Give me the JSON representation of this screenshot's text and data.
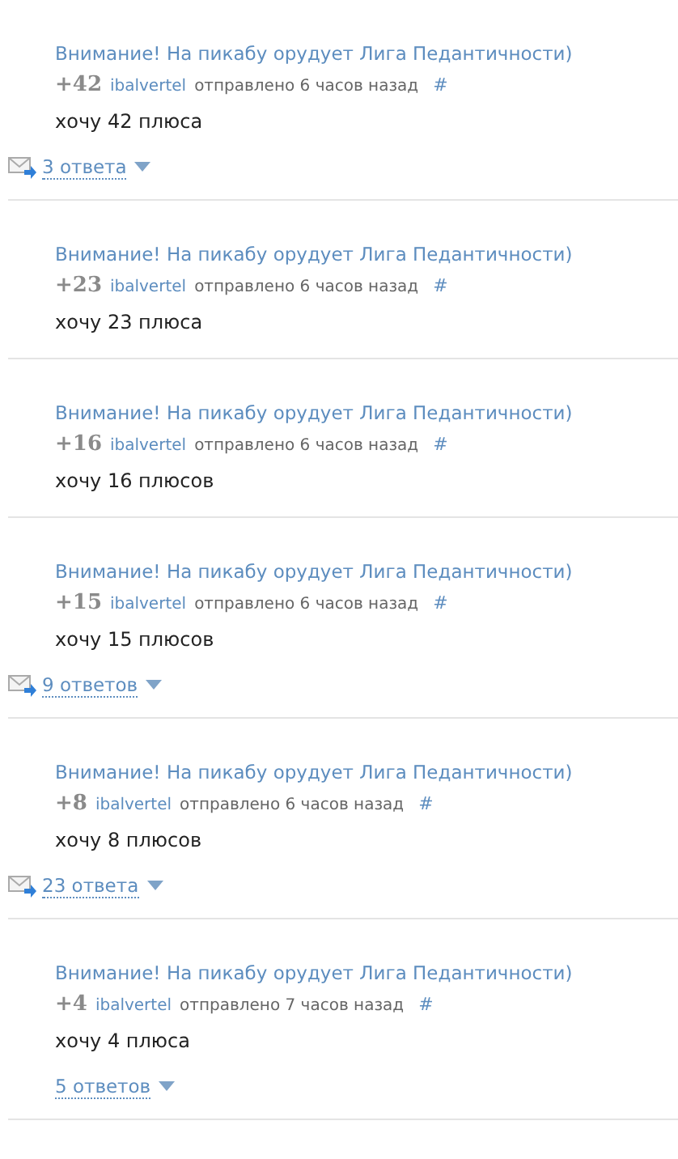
{
  "comments": [
    {
      "title": "Внимание! На пикабу орудует Лига Педантичности)",
      "score": "+42",
      "author": "ibalvertel",
      "meta": "отправлено 6 часов назад",
      "anchor": "#",
      "body": "хочу 42 плюса",
      "replies": {
        "label": "3 ответа",
        "unread": true
      }
    },
    {
      "title": "Внимание! На пикабу орудует Лига Педантичности)",
      "score": "+23",
      "author": "ibalvertel",
      "meta": "отправлено 6 часов назад",
      "anchor": "#",
      "body": "хочу 23 плюса"
    },
    {
      "title": "Внимание! На пикабу орудует Лига Педантичности)",
      "score": "+16",
      "author": "ibalvertel",
      "meta": "отправлено 6 часов назад",
      "anchor": "#",
      "body": "хочу 16 плюсов"
    },
    {
      "title": "Внимание! На пикабу орудует Лига Педантичности)",
      "score": "+15",
      "author": "ibalvertel",
      "meta": "отправлено 6 часов назад",
      "anchor": "#",
      "body": "хочу 15 плюсов",
      "replies": {
        "label": "9 ответов",
        "unread": true
      }
    },
    {
      "title": "Внимание! На пикабу орудует Лига Педантичности)",
      "score": "+8",
      "author": "ibalvertel",
      "meta": "отправлено 6 часов назад",
      "anchor": "#",
      "body": "хочу 8 плюсов",
      "replies": {
        "label": "23 ответа",
        "unread": true
      }
    },
    {
      "title": "Внимание! На пикабу орудует Лига Педантичности)",
      "score": "+4",
      "author": "ibalvertel",
      "meta": "отправлено 7 часов назад",
      "anchor": "#",
      "body": "хочу 4 плюса",
      "replies": {
        "label": "5 ответов",
        "unread": false
      }
    }
  ]
}
